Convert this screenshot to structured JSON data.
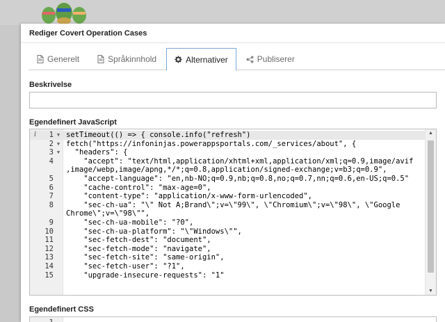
{
  "dialog": {
    "title": "Rediger Covert Operation Cases"
  },
  "tabs": [
    {
      "label": "Generelt",
      "icon": "document-icon",
      "active": false
    },
    {
      "label": "Språkinnhold",
      "icon": "document-icon",
      "active": false
    },
    {
      "label": "Alternativer",
      "icon": "gear-icon",
      "active": true
    },
    {
      "label": "Publiserer",
      "icon": "share-icon",
      "active": false
    }
  ],
  "fields": {
    "description_label": "Beskrivelse",
    "description_value": "",
    "js_label": "Egendefinert JavaScript",
    "css_label": "Egendefinert CSS"
  },
  "editor": {
    "lines": [
      {
        "n": "1",
        "fold": true,
        "text": "setTimeout(() => { console.info(\"refresh\")"
      },
      {
        "n": "2",
        "fold": true,
        "text": "fetch(\"https://infoninjas.powerappsportals.com/_services/about\", {"
      },
      {
        "n": "3",
        "fold": true,
        "text": "  \"headers\": {"
      },
      {
        "n": "4",
        "fold": false,
        "text": "    \"accept\": \"text/html,application/xhtml+xml,application/xml;q=0.9,image/avif"
      },
      {
        "n": "",
        "fold": false,
        "text": ",image/webp,image/apng,*/*;q=0.8,application/signed-exchange;v=b3;q=0.9\","
      },
      {
        "n": "5",
        "fold": false,
        "text": "    \"accept-language\": \"en,nb-NO;q=0.9,nb;q=0.8,no;q=0.7,nn;q=0.6,en-US;q=0.5\""
      },
      {
        "n": "6",
        "fold": false,
        "text": "    \"cache-control\": \"max-age=0\","
      },
      {
        "n": "7",
        "fold": false,
        "text": "    \"content-type\": \"application/x-www-form-urlencoded\","
      },
      {
        "n": "8",
        "fold": false,
        "text": "    \"sec-ch-ua\": \"\\\" Not A;Brand\\\";v=\\\"99\\\", \\\"Chromium\\\";v=\\\"98\\\", \\\"Google"
      },
      {
        "n": "",
        "fold": false,
        "text": "Chrome\\\";v=\\\"98\\\"\","
      },
      {
        "n": "9",
        "fold": false,
        "text": "    \"sec-ch-ua-mobile\": \"?0\","
      },
      {
        "n": "10",
        "fold": false,
        "text": "    \"sec-ch-ua-platform\": \"\\\"Windows\\\"\","
      },
      {
        "n": "11",
        "fold": false,
        "text": "    \"sec-fetch-dest\": \"document\","
      },
      {
        "n": "12",
        "fold": false,
        "text": "    \"sec-fetch-mode\": \"navigate\","
      },
      {
        "n": "13",
        "fold": false,
        "text": "    \"sec-fetch-site\": \"same-origin\","
      },
      {
        "n": "14",
        "fold": false,
        "text": "    \"sec-fetch-user\": \"?1\","
      },
      {
        "n": "15",
        "fold": false,
        "text": "    \"upgrade-insecure-requests\": \"1\""
      }
    ]
  },
  "css_editor": {
    "lines": [
      {
        "n": "1",
        "text": ""
      }
    ]
  }
}
